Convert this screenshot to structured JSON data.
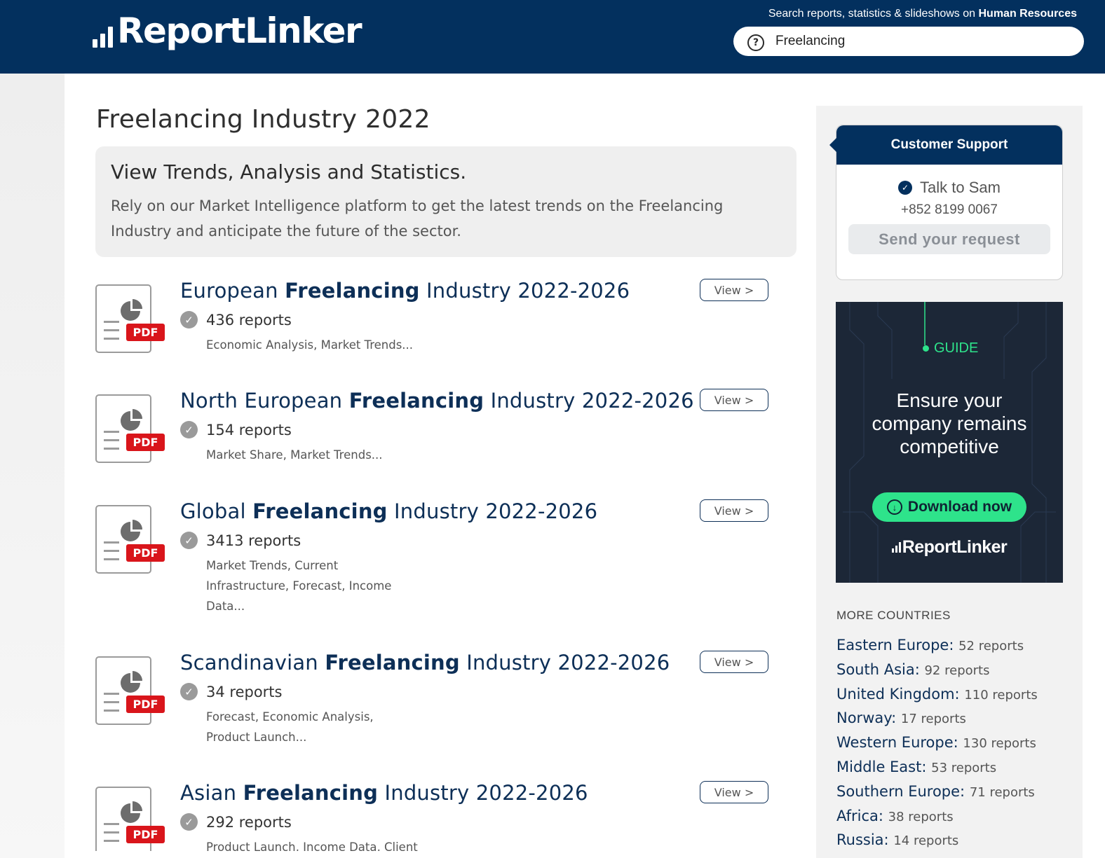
{
  "header": {
    "logo_text": "ReportLinker",
    "search_hint_prefix": "Search reports, statistics & slideshows on ",
    "search_hint_topic": "Human Resources",
    "search_value": "Freelancing"
  },
  "main": {
    "title": "Freelancing Industry 2022",
    "intro_heading": "View Trends, Analysis and Statistics.",
    "intro_text": "Rely on our Market Intelligence platform to get the latest trends on the Freelancing Industry and anticipate the future of the sector.",
    "pdf_label": "PDF",
    "view_label": "View >",
    "reports": [
      {
        "prefix": "European ",
        "keyword": "Freelancing",
        "suffix": " Industry 2022-2026",
        "count": "436 reports",
        "tags": "Economic Analysis, Market Trends..."
      },
      {
        "prefix": "North European ",
        "keyword": "Freelancing",
        "suffix": " Industry 2022-2026",
        "count": "154 reports",
        "tags": "Market Share, Market Trends..."
      },
      {
        "prefix": "Global ",
        "keyword": "Freelancing",
        "suffix": " Industry 2022-2026",
        "count": "3413 reports",
        "tags": "Market Trends, Current Infrastructure, Forecast, Income Data..."
      },
      {
        "prefix": "Scandinavian ",
        "keyword": "Freelancing",
        "suffix": " Industry 2022-2026",
        "count": "34 reports",
        "tags": "Forecast, Economic Analysis, Product Launch..."
      },
      {
        "prefix": "Asian ",
        "keyword": "Freelancing",
        "suffix": " Industry 2022-2026",
        "count": "292 reports",
        "tags": "Product Launch, Income Data, Client"
      }
    ]
  },
  "sidebar": {
    "support": {
      "title": "Customer Support",
      "talk": "Talk to Sam",
      "phone": "+852 8199 0067",
      "send_label": "Send your request"
    },
    "ad": {
      "tag": "GUIDE",
      "headline_1": "Ensure your",
      "headline_2": "company remains",
      "headline_3": "competitive",
      "download_label": "Download now",
      "logo_text": "ReportLinker"
    },
    "more_heading": "MORE COUNTRIES",
    "countries": [
      {
        "name": "Eastern Europe:",
        "count": "52 reports"
      },
      {
        "name": "South Asia:",
        "count": "92 reports"
      },
      {
        "name": "United Kingdom:",
        "count": "110 reports"
      },
      {
        "name": "Norway:",
        "count": "17 reports"
      },
      {
        "name": "Western Europe:",
        "count": "130 reports"
      },
      {
        "name": "Middle East:",
        "count": "53 reports"
      },
      {
        "name": "Southern Europe:",
        "count": "71 reports"
      },
      {
        "name": "Africa:",
        "count": "38 reports"
      },
      {
        "name": "Russia:",
        "count": "14 reports"
      }
    ]
  },
  "colors": {
    "brand_navy": "#03305e",
    "pdf_red": "#d9151b",
    "guide_green": "#2ee38b"
  }
}
